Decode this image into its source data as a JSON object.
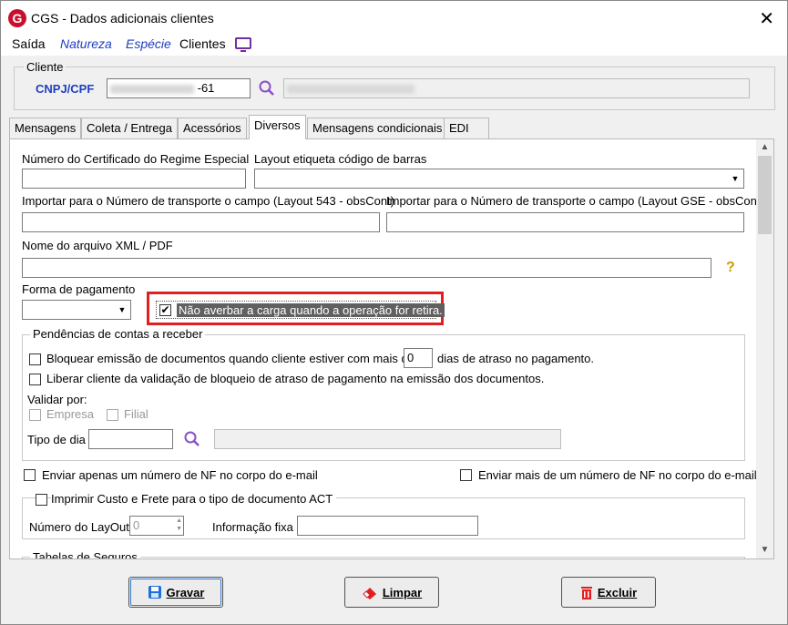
{
  "window": {
    "title": "CGS - Dados adicionais clientes",
    "logo_letter": "G",
    "close_glyph": "✕"
  },
  "menu": {
    "saida": "Saída",
    "natureza": "Natureza",
    "especie": "Espécie",
    "clientes": "Clientes"
  },
  "client": {
    "group_label": "Cliente",
    "cnpj_label": "CNPJ/CPF",
    "cnpj_value_suffix": "-61"
  },
  "tabs": [
    "Mensagens",
    "Coleta / Entrega",
    "Acessórios",
    "Diversos",
    "Mensagens condicionais",
    "EDI"
  ],
  "fields": {
    "certificado_label": "Número do Certificado do Regime Especial",
    "layout_etiqueta_label": "Layout etiqueta código de barras",
    "importar_543_label": "Importar para o Número de transporte o campo (Layout 543 - obsCont)",
    "importar_gse_label": "Importar para o Número de transporte o campo (Layout GSE - obsCont)",
    "arquivo_label": "Nome do arquivo XML / PDF",
    "forma_pagamento_label": "Forma de pagamento",
    "nao_averbar_label": "Não averbar a carga quando a operação for retira.",
    "help_glyph": "?"
  },
  "pendencias": {
    "group_label": "Pendências de contas a receber",
    "bloquear_prefix": "Bloquear emissão de documentos quando cliente estiver com mais de",
    "dias_value": "0",
    "bloquear_suffix": "dias de atraso no pagamento.",
    "liberar_label": "Liberar cliente da validação de bloqueio de atraso de pagamento na emissão dos documentos.",
    "validar_label": "Validar por:",
    "empresa_label": "Empresa",
    "filial_label": "Filial",
    "tipo_dia_label": "Tipo de dia"
  },
  "email": {
    "apenas_um_label": "Enviar apenas um número de NF no corpo do e-mail",
    "mais_de_um_label": "Enviar mais de um número de NF no corpo do e-mail"
  },
  "act": {
    "group_label": "Imprimir Custo e Frete para o tipo de documento ACT",
    "layout_label": "Número do LayOut",
    "layout_value": "0",
    "info_label": "Informação fixa"
  },
  "seguros": {
    "group_label": "Tabelas de Seguros"
  },
  "buttons": {
    "gravar": "Gravar",
    "limpar": "Limpar",
    "excluir": "Excluir"
  },
  "colors": {
    "highlight": "#e02020",
    "accent_blue": "#1f3fbf",
    "icon_purple": "#8a4fc7"
  }
}
